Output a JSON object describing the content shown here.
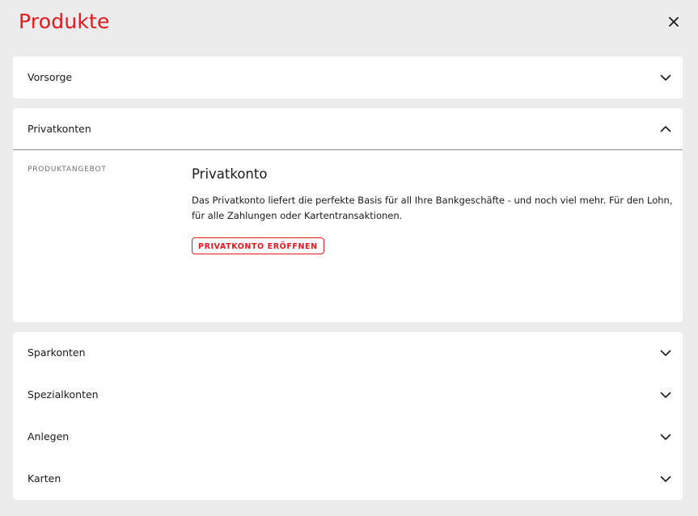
{
  "header": {
    "title": "Produkte",
    "close_icon": "close-icon"
  },
  "accordion": {
    "vorsorge": {
      "label": "Vorsorge",
      "expanded": false
    },
    "privatkonten": {
      "label": "Privatkonten",
      "expanded": true,
      "section_label": "PRODUKTANGEBOT",
      "product_title": "Privatkonto",
      "product_description": "Das Privatkonto liefert die perfekte Basis für all Ihre Bankgeschäfte - und noch viel mehr. Für den Lohn, für alle Zahlungen oder Kartentransaktionen.",
      "cta_label": "PRIVATKONTO ERÖFFNEN"
    },
    "items": [
      {
        "label": "Sparkonten",
        "expanded": false
      },
      {
        "label": "Spezialkonten",
        "expanded": false
      },
      {
        "label": "Anlegen",
        "expanded": false
      },
      {
        "label": "Karten",
        "expanded": false
      }
    ]
  },
  "colors": {
    "accent": "#e3181c",
    "background": "#ececec",
    "card": "#ffffff",
    "divider": "#8c8c8c"
  }
}
